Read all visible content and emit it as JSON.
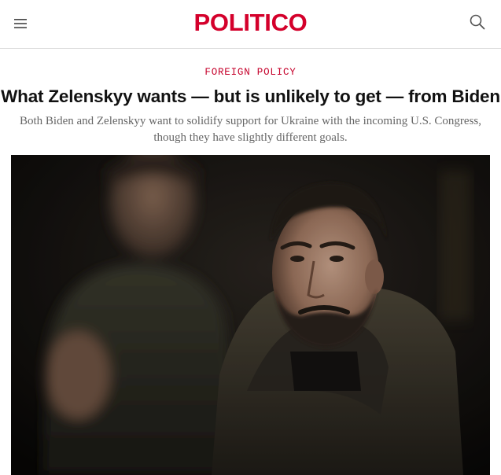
{
  "site": {
    "logo": "POLITICO",
    "menu_icon": "hamburger-menu-icon",
    "search_icon": "search-icon",
    "brand_color": "#d4002b"
  },
  "article": {
    "section": "FOREIGN POLICY",
    "headline": "What Zelenskyy wants — but is unlikely to get — from Biden",
    "dek": "Both Biden and Zelenskyy want to solidify support for Ukraine with the incoming U.S. Congress, though they have slightly different goals."
  }
}
